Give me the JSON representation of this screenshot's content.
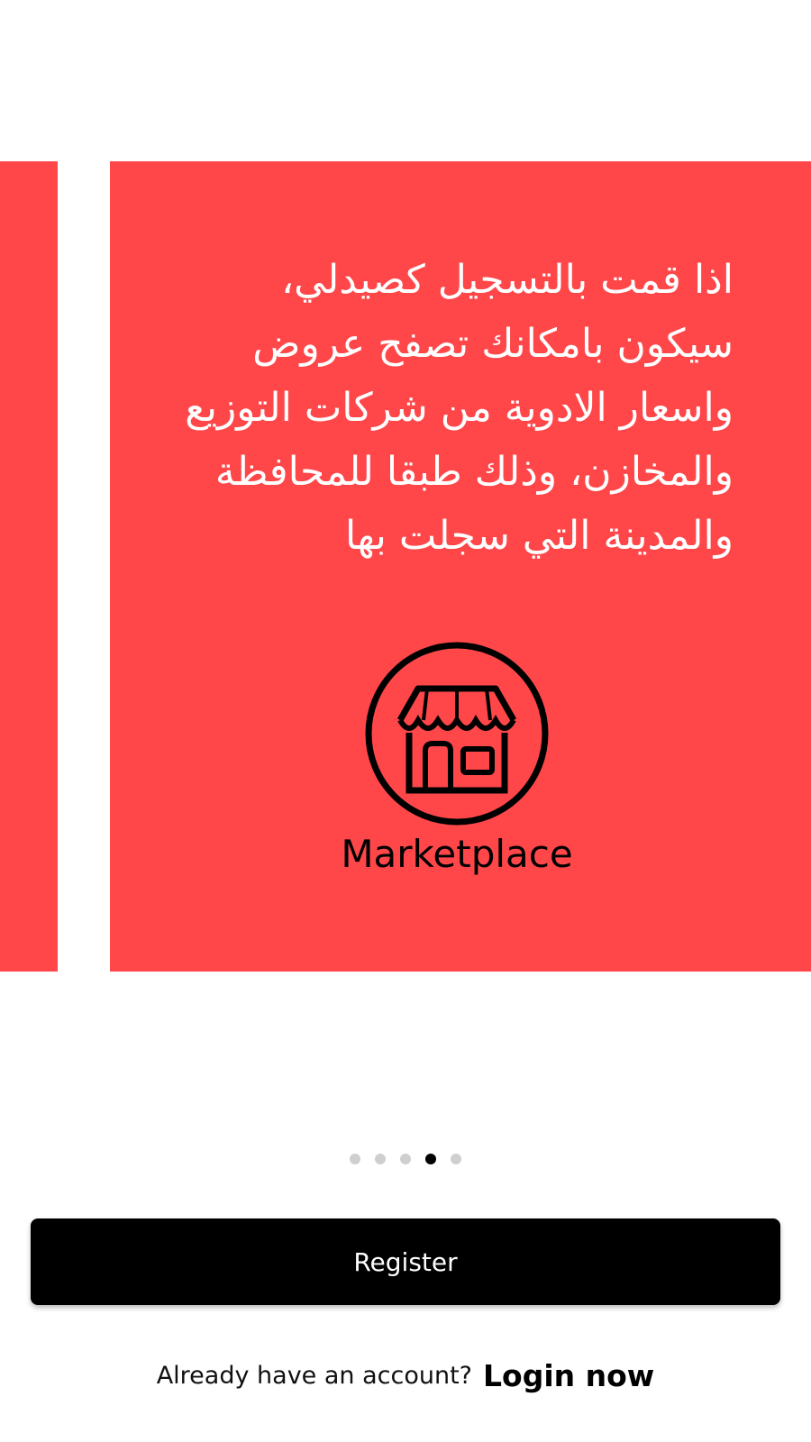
{
  "colors": {
    "slide_background": "#ff474a",
    "button_background": "#000000",
    "button_text": "#ffffff",
    "dot_inactive": "#cfcfcf",
    "dot_active": "#000000"
  },
  "carousel": {
    "current_slide": {
      "text": "اذا قمت بالتسجيل كصيدلي، سيكون بامكانك تصفح عروض واسعار الادوية من شركات التوزيع والمخازن، وذلك طبقا للمحافظة والمدينة التي سجلت بها",
      "icon": "marketplace-store-icon",
      "label": "Marketplace"
    },
    "page_indicator": {
      "count": 5,
      "active_index": 3
    }
  },
  "actions": {
    "register_label": "Register",
    "login_prompt": "Already have an account?",
    "login_link": "Login now"
  }
}
